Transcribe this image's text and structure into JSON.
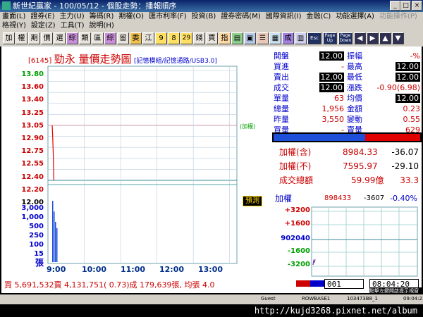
{
  "window": {
    "title": "新世紀贏家 - 100/05/12 - 個股走勢：播報順序",
    "min": "_",
    "max": "□",
    "close": "×"
  },
  "menu": {
    "row1": [
      "畫面(L)",
      "證券(E)",
      "主力(U)",
      "籌碼(R)",
      "期權(O)",
      "匯市利率(F)",
      "投資(B)",
      "證券密碼(M)",
      "國際資訊(I)",
      "金融(C)",
      "功能選擇(A)",
      "功能操作(P)"
    ],
    "row2": [
      "格視(Y)",
      "設定(Z)",
      "工具(T)",
      "說明(H)"
    ]
  },
  "toolbar": {
    "buttons": [
      "加",
      "權",
      "期",
      "價",
      "選",
      "綜",
      "類",
      "區",
      "綜",
      "留",
      "委",
      "江",
      "9",
      "8",
      "29",
      "錢",
      "買",
      "指",
      "",
      "",
      "",
      "",
      "成",
      "",
      "Esc",
      "Page Up",
      "Page Down",
      "",
      "",
      "",
      ""
    ]
  },
  "chart": {
    "code": "[6145]",
    "title": "勁永  量價走勢圖",
    "links": "[記憶模組/記憶通路/USB3.0]",
    "price_ticks": [
      "13.80",
      "13.60",
      "13.40",
      "13.25",
      "13.05",
      "12.90",
      "12.75",
      "12.55",
      "12.40",
      "12.20",
      "12.00"
    ],
    "limit_down_mark": "(加權)",
    "predict_label": "預測",
    "volume_ticks": [
      "3,000",
      "1,000",
      "500",
      "250",
      "100",
      "30",
      "15",
      "張"
    ],
    "time_ticks": [
      "9:00",
      "10:00",
      "11:00",
      "12:00",
      "13:00"
    ],
    "summary": "買 5,691,532賣 4,131,751( 0.73)成 179,639張, 均張 4.0"
  },
  "chart_data": {
    "type": "line",
    "x": [
      "9:00",
      "9:01",
      "9:02",
      "9:03"
    ],
    "series": [
      {
        "values": [
          12.9,
          12.7,
          12.4,
          12.0
        ]
      }
    ],
    "ylim": [
      12.0,
      13.8
    ],
    "volume": [
      800,
      250,
      80,
      40
    ]
  },
  "quote": {
    "rows": [
      {
        "k1": "開盤",
        "v1": "12.00",
        "k2": "振幅",
        "v2": "-%"
      },
      {
        "k1": "買進",
        "v1": "-",
        "k2": "最高",
        "v2": "12.00"
      },
      {
        "k1": "賣出",
        "v1": "12.00",
        "k2": "最低",
        "v2": "12.00"
      },
      {
        "k1": "成交",
        "v1": "12.00",
        "k2": "漲跌",
        "v2": "-0.90(6.98)"
      },
      {
        "k1": "單量",
        "v1": "63",
        "k2": "均價",
        "v2": "12.00"
      },
      {
        "k1": "總量",
        "v1": "1,956",
        "k2": "金額",
        "v2": "0.23"
      },
      {
        "k1": "昨量",
        "v1": "3,550",
        "k2": "變動",
        "v2": "0.55"
      },
      {
        "k1": "買量",
        "v1": "-",
        "k2": "賣量",
        "v2": "629"
      }
    ]
  },
  "index": {
    "incl_label": "加權(含)",
    "incl_value": "8984.33",
    "incl_change": "-36.07",
    "excl_label": "加權(不)",
    "excl_value": "7595.97",
    "excl_change": "-29.10",
    "turnover_label": "成交總額",
    "turnover_value": "59.99億",
    "turnover_change": "33.3"
  },
  "mini": {
    "label": "加權",
    "value": "898433",
    "change": "-3607",
    "pct": "-0.40%",
    "ticks": [
      "+3200",
      "+1600",
      "902040",
      "-1600",
      "-3200"
    ]
  },
  "status": {
    "box": "001",
    "time_box": "08:04:20",
    "user": "Guest",
    "server": "ROWBASE1",
    "id": "103473B8_1",
    "clock": "09:04:21",
    "hint": "點擊左鍵開啟提示視窗"
  },
  "watermark": "http://kujd3268.pixnet.net/album",
  "colors": {
    "up": "#e00000",
    "down": "#00a000",
    "label": "#0000cc",
    "axis": "#002e8a"
  }
}
